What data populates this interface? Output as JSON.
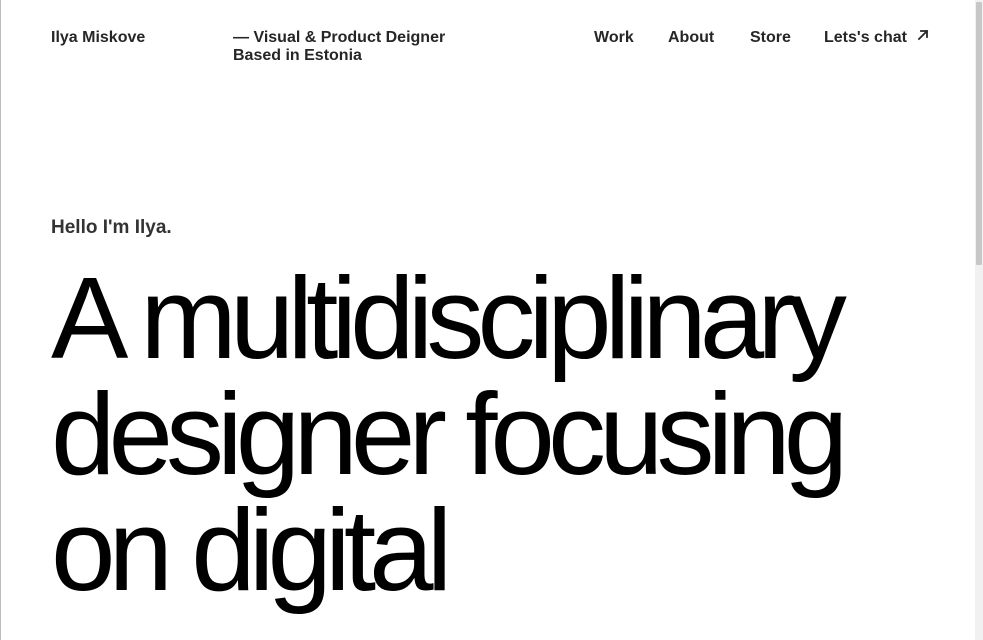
{
  "header": {
    "brand": "Ilya Miskove",
    "tagline_line1": "— Visual & Product Deigner",
    "tagline_line2": "Based in Estonia",
    "nav": {
      "work": "Work",
      "about": "About",
      "store": "Store",
      "chat": "Lets's chat",
      "chat_icon": "arrow-up-right-icon"
    }
  },
  "hero": {
    "intro": "Hello I'm Ilya.",
    "headline_lines": [
      "A multidisciplinary",
      "designer focusing",
      "on digital"
    ]
  },
  "colors": {
    "text": "#222222",
    "headline": "#000000",
    "background": "#ffffff"
  }
}
